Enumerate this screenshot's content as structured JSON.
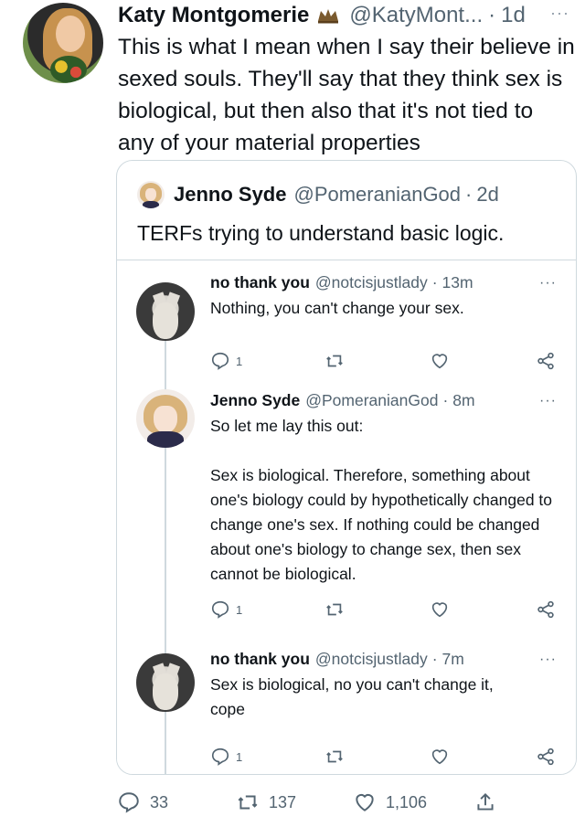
{
  "main_tweet": {
    "author_name": "Katy Montgomerie",
    "handle": "@KatyMont...",
    "separator": "·",
    "time": "1d",
    "more": "···",
    "text": "This is what I mean when I say their believe in sexed souls. They'll say that they think sex is biological, but then also that it's not tied to any of your material properties",
    "stats": {
      "replies": "33",
      "retweets": "137",
      "likes": "1,106"
    }
  },
  "quote": {
    "author_name": "Jenno Syde",
    "handle": "@PomeranianGod",
    "separator": "·",
    "time": "2d",
    "text": "TERFs trying to understand basic logic.",
    "replies": [
      {
        "author_name": "no thank you",
        "handle": "@notcisjustlady",
        "separator": "·",
        "time": "13m",
        "more": "···",
        "text": "Nothing, you can't change your sex.",
        "reply_count": "1"
      },
      {
        "author_name": "Jenno Syde",
        "handle": "@PomeranianGod",
        "separator": "·",
        "time": "8m",
        "more": "···",
        "text_line1": "So let me lay this out:",
        "text_para2": "Sex is biological. Therefore, something about one's biology could by hypothetically changed to change one's sex. If nothing could be changed about one's biology to change sex, then sex cannot be biological.",
        "reply_count": "1"
      },
      {
        "author_name": "no thank you",
        "handle": "@notcisjustlady",
        "separator": "·",
        "time": "7m",
        "more": "···",
        "text": "Sex is biological, no you can't change it, cope",
        "reply_count": "1"
      }
    ]
  },
  "icons": {
    "reply": "reply-icon",
    "retweet": "retweet-icon",
    "like": "heart-icon",
    "share": "share-icon",
    "badge": "crown-icon"
  },
  "colors": {
    "text": "#0f1419",
    "muted": "#536471",
    "border": "#cfd9de"
  }
}
